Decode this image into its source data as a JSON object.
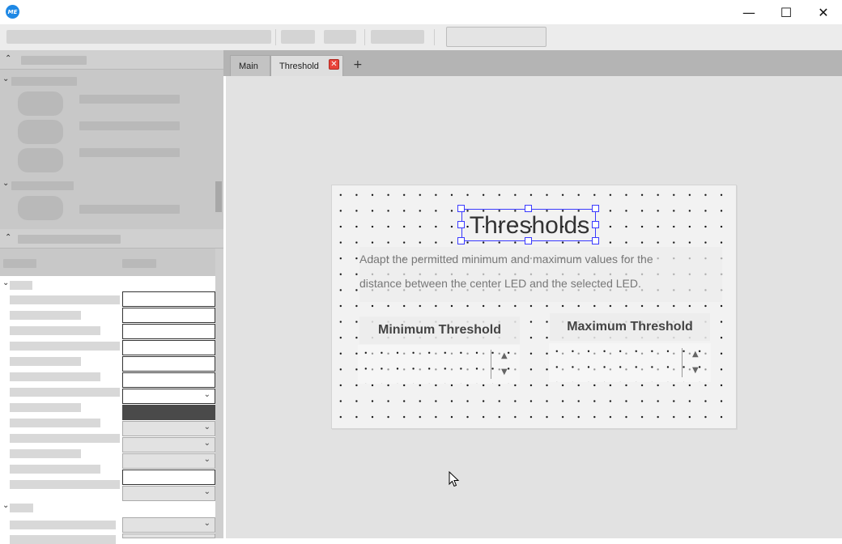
{
  "app": {
    "logo_text": "ME"
  },
  "window_controls": {
    "minimize": "—",
    "maximize": "☐",
    "close": "✕"
  },
  "tabs": [
    {
      "label": "Main",
      "active": false
    },
    {
      "label": "Threshold",
      "active": true,
      "closable": true
    }
  ],
  "tab_close_glyph": "✕",
  "tab_add_glyph": "+",
  "canvas": {
    "title": "Thresholds",
    "description_lines": [
      "Adapt the permitted minimum and maximum values for the",
      "distance between the center LED and the selected LED."
    ],
    "min_label": "Minimum Threshold",
    "max_label": "Maximum Threshold",
    "spin_up": "▲",
    "spin_down": "▼"
  },
  "left_panel": {
    "section_collapse_glyph": "⌃",
    "group_expand_glyph": "⌄",
    "combo_glyph": "⌄"
  },
  "colors": {
    "accent_selection": "#3a3aff",
    "close_tab": "#e8433a",
    "logo": "#1e88e5"
  }
}
